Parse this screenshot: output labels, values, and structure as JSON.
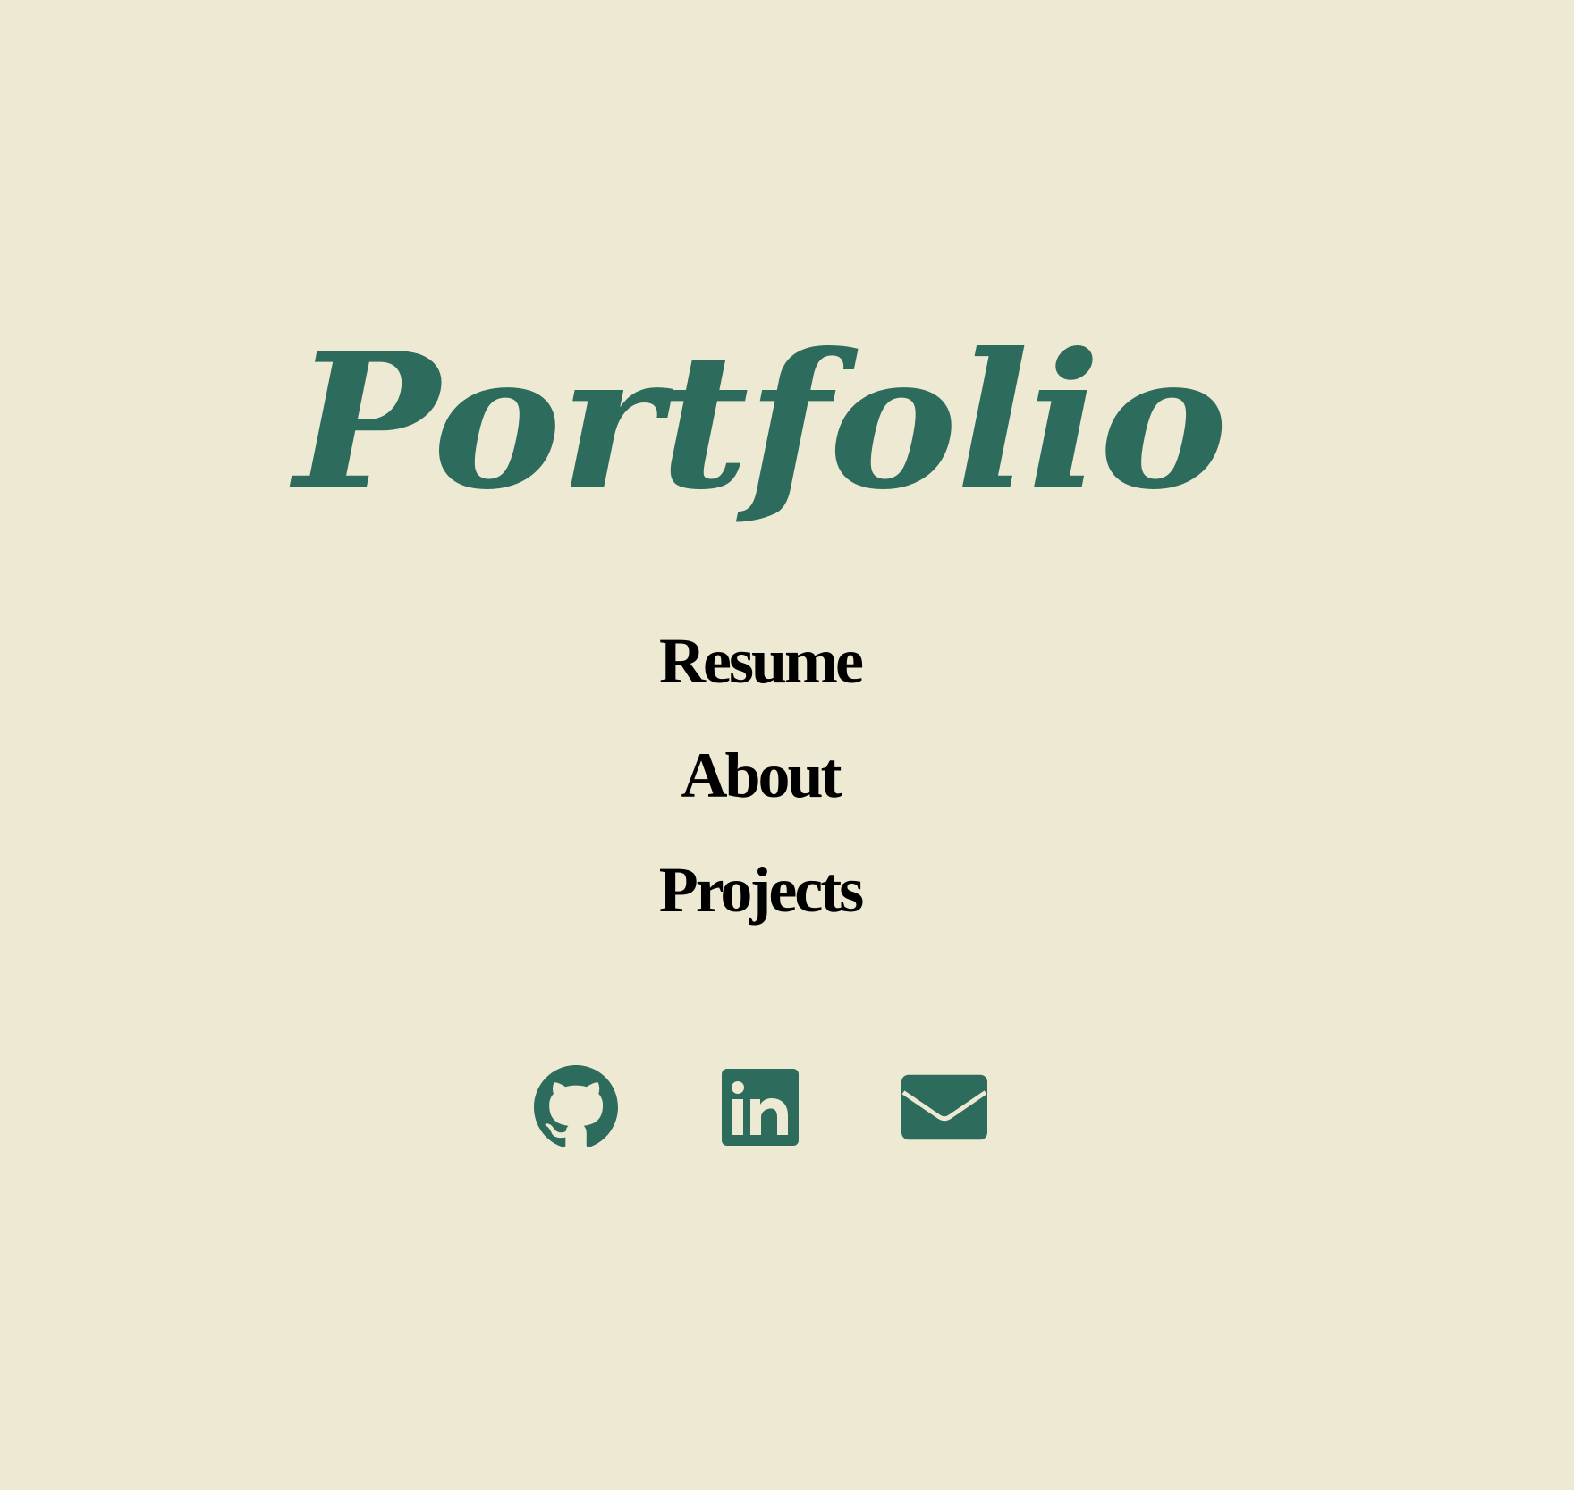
{
  "colors": {
    "background": "#EEE9D3",
    "accent": "#2D6B5D",
    "nav_text": "#000000"
  },
  "header": {
    "title": "Portfolio"
  },
  "nav": {
    "items": [
      {
        "label": "Resume"
      },
      {
        "label": "About"
      },
      {
        "label": "Projects"
      }
    ]
  },
  "socials": {
    "items": [
      {
        "icon": "github-icon"
      },
      {
        "icon": "linkedin-icon"
      },
      {
        "icon": "mail-icon"
      }
    ]
  }
}
